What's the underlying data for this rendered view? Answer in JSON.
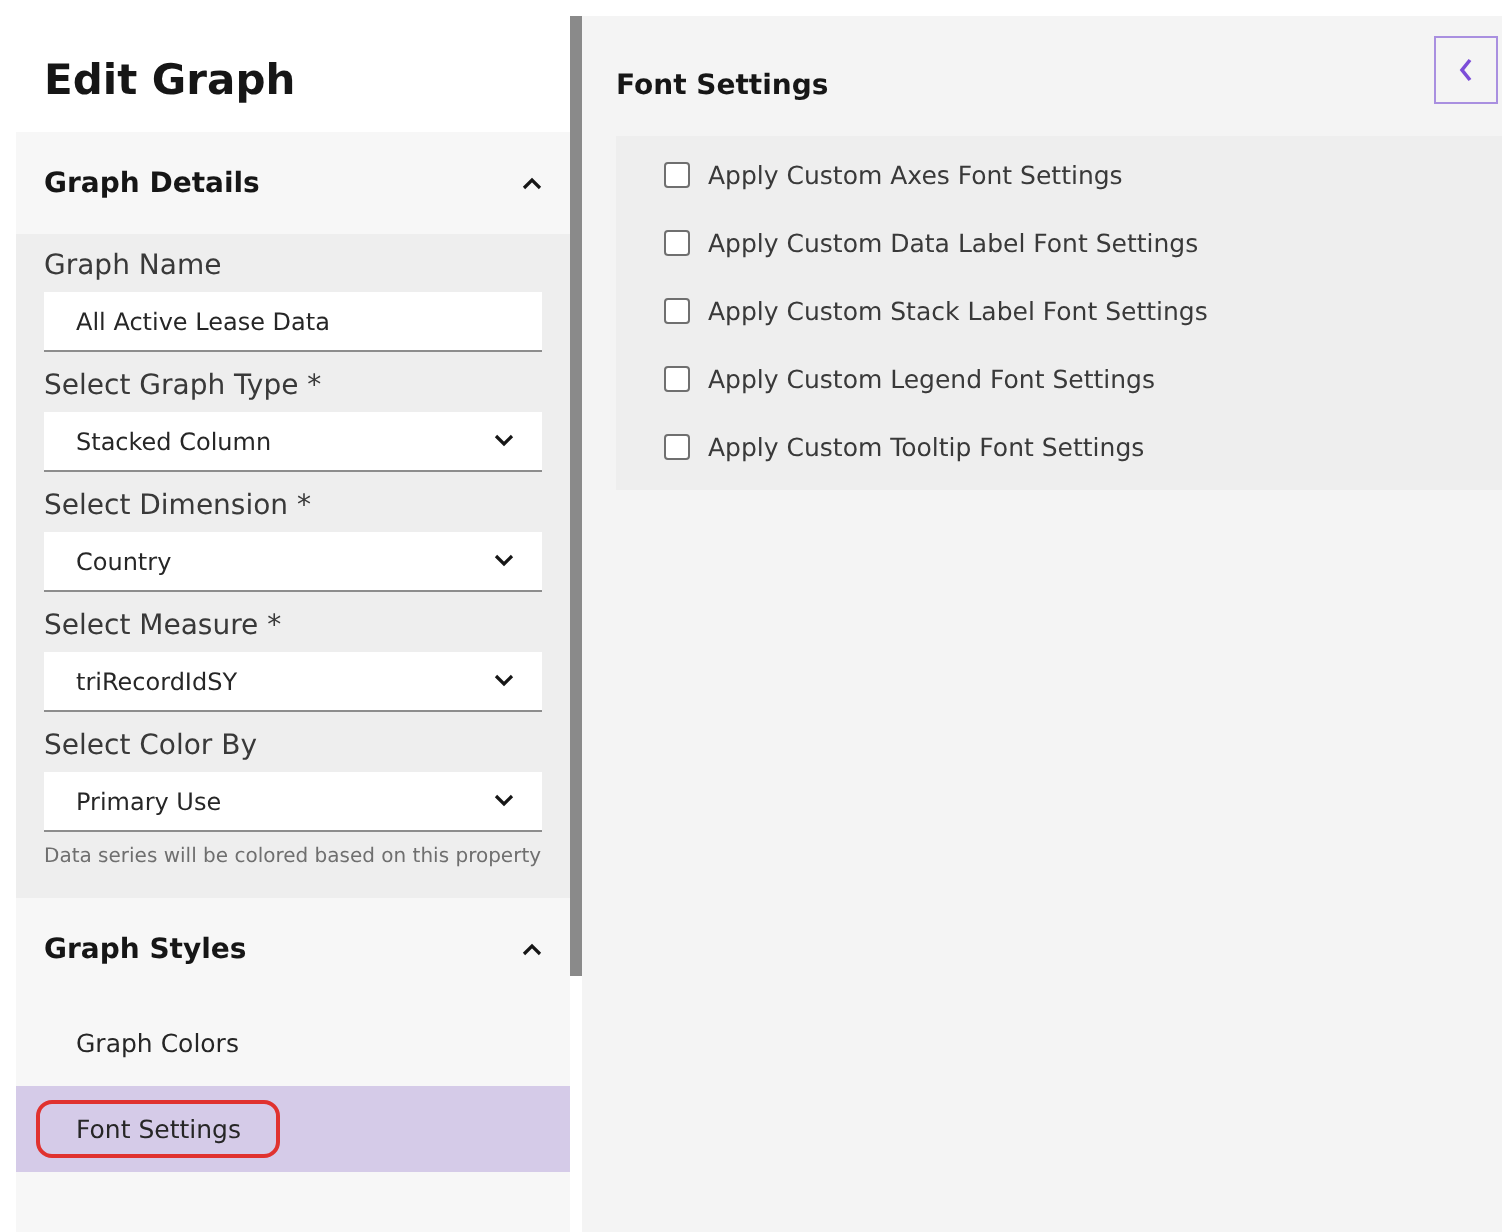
{
  "sidebar": {
    "title": "Edit Graph",
    "sections": [
      {
        "title": "Graph Details",
        "expanded": true,
        "fields": [
          {
            "kind": "text",
            "label": "Graph Name",
            "value": "All Active Lease Data"
          },
          {
            "kind": "select",
            "label": "Select Graph Type *",
            "value": "Stacked Column"
          },
          {
            "kind": "select",
            "label": "Select Dimension  *",
            "value": "Country"
          },
          {
            "kind": "select",
            "label": "Select Measure  *",
            "value": "triRecordIdSY"
          },
          {
            "kind": "select",
            "label": "Select Color By",
            "value": "Primary Use",
            "help": "Data series will be colored based on this property"
          }
        ]
      },
      {
        "title": "Graph Styles",
        "expanded": true,
        "items": [
          {
            "label": "Graph Colors",
            "selected": false,
            "circled": false
          },
          {
            "label": "Font Settings",
            "selected": true,
            "circled": true
          }
        ]
      }
    ]
  },
  "main": {
    "title": "Font Settings",
    "options": [
      {
        "label": "Apply Custom Axes Font Settings",
        "checked": false
      },
      {
        "label": "Apply Custom Data Label Font Settings",
        "checked": false
      },
      {
        "label": "Apply Custom Stack Label Font Settings",
        "checked": false
      },
      {
        "label": "Apply Custom Legend Font Settings",
        "checked": false
      },
      {
        "label": "Apply Custom Tooltip Font Settings",
        "checked": false
      }
    ]
  }
}
